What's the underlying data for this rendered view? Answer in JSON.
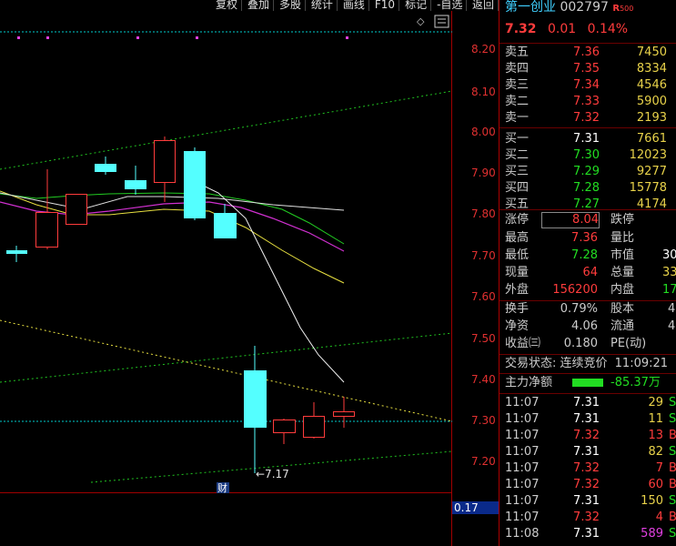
{
  "toolbar": {
    "buttons": [
      "复权",
      "叠加",
      "多股",
      "统计",
      "画线",
      "F10",
      "标记",
      "-自选",
      "返回"
    ]
  },
  "chart": {
    "price_axis": [
      "8.20",
      "8.10",
      "8.00",
      "7.90",
      "7.80",
      "7.70",
      "7.60",
      "7.50",
      "7.40",
      "7.30",
      "7.20"
    ],
    "low_marker": "←7.17",
    "event_marker": "财",
    "indicator_value": "0.17",
    "colors": {
      "up": "#ff3c3c",
      "down": "#54ffff",
      "grid": "#3a0000",
      "guide": "#00cccc"
    }
  },
  "quote": {
    "name": "第一创业",
    "code": "002797",
    "tag": "R",
    "tag_sub": "500",
    "price": "7.32",
    "change": "0.01",
    "pct": "0.14%"
  },
  "order_book": {
    "asks": [
      {
        "label": "卖五",
        "price": "7.36",
        "vol": "7450"
      },
      {
        "label": "卖四",
        "price": "7.35",
        "vol": "8334"
      },
      {
        "label": "卖三",
        "price": "7.34",
        "vol": "4546"
      },
      {
        "label": "卖二",
        "price": "7.33",
        "vol": "5900"
      },
      {
        "label": "卖一",
        "price": "7.32",
        "vol": "2193"
      }
    ],
    "bids": [
      {
        "label": "买一",
        "price": "7.31",
        "vol": "7661"
      },
      {
        "label": "买二",
        "price": "7.30",
        "vol": "12023"
      },
      {
        "label": "买三",
        "price": "7.29",
        "vol": "9277"
      },
      {
        "label": "买四",
        "price": "7.28",
        "vol": "15778"
      },
      {
        "label": "买五",
        "price": "7.27",
        "vol": "4174"
      }
    ]
  },
  "stats": {
    "limit_up_label": "涨停",
    "limit_up": "8.04",
    "limit_down_label": "跌停",
    "high_label": "最高",
    "high": "7.36",
    "vol_ratio_label": "量比",
    "low_label": "最低",
    "low": "7.28",
    "mktcap_label": "市值",
    "mktcap": "30",
    "cur_vol_label": "现量",
    "cur_vol": "64",
    "total_vol_label": "总量",
    "total_vol": "33",
    "outer_label": "外盘",
    "outer": "156200",
    "inner_label": "内盘",
    "inner": "17",
    "turnover_label": "换手",
    "turnover": "0.79%",
    "shares_label": "股本",
    "shares": "4",
    "nav_label": "净资",
    "nav": "4.06",
    "float_label": "流通",
    "float": "4",
    "eps_label": "收益㈢",
    "eps": "0.180",
    "pe_label": "PE(动)"
  },
  "status": {
    "text": "交易状态: 连续竞价",
    "time": "11:09:21"
  },
  "net_flow": {
    "label": "主力净额",
    "value": "-85.37万"
  },
  "ticks": [
    {
      "time": "11:07",
      "price": "7.31",
      "vol": "29",
      "side": "S"
    },
    {
      "time": "11:07",
      "price": "7.31",
      "vol": "11",
      "side": "S"
    },
    {
      "time": "11:07",
      "price": "7.32",
      "vol": "13",
      "side": "B"
    },
    {
      "time": "11:07",
      "price": "7.31",
      "vol": "82",
      "side": "S"
    },
    {
      "time": "11:07",
      "price": "7.32",
      "vol": "7",
      "side": "B"
    },
    {
      "time": "11:07",
      "price": "7.32",
      "vol": "60",
      "side": "B"
    },
    {
      "time": "11:07",
      "price": "7.31",
      "vol": "150",
      "side": "S"
    },
    {
      "time": "11:07",
      "price": "7.32",
      "vol": "4",
      "side": "B"
    },
    {
      "time": "11:08",
      "price": "7.31",
      "vol": "589",
      "side": "S"
    }
  ]
}
